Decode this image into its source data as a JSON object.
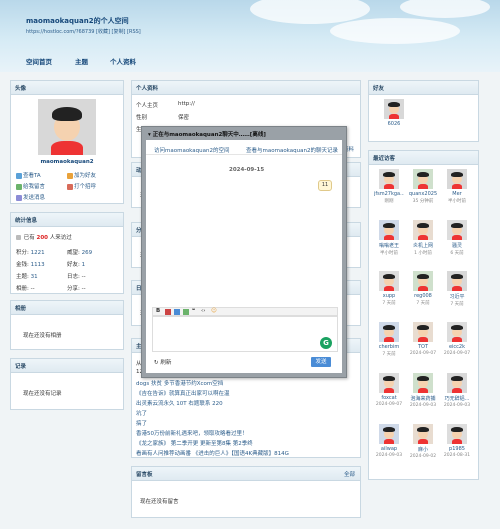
{
  "header": {
    "title": "maomaokaquan2的个人空间",
    "url": "https://hostloc.com/?68739",
    "links": [
      "[收藏]",
      "[复制]",
      "[RSS]"
    ]
  },
  "nav": [
    "空间首页",
    "主题",
    "个人资料"
  ],
  "avatar_panel": {
    "title": "头像",
    "username": "maomaokaquan2",
    "actions": [
      "查看TA",
      "加为好友",
      "给我留言",
      "打个招呼",
      "发送消息"
    ]
  },
  "stats_panel": {
    "title": "统计信息",
    "visits_prefix": "已有",
    "visits_count": "200",
    "visits_suffix": "人来访过",
    "rows": [
      {
        "label": "积分:",
        "value": "1221",
        "label2": "威望:",
        "value2": "269"
      },
      {
        "label": "金钱:",
        "value": "1113",
        "label2": "好友:",
        "value2": "1"
      },
      {
        "label": "主题:",
        "value": "31",
        "label2": "日志:",
        "value2": "--"
      },
      {
        "label": "相册:",
        "value": "--",
        "label2": "分享:",
        "value2": "--"
      }
    ]
  },
  "album_panel": {
    "title": "相册",
    "empty": "现在还没有相册"
  },
  "record_panel": {
    "title": "记录",
    "empty": "现在还没有记录"
  },
  "profile_panel": {
    "title": "个人资料",
    "rows": [
      {
        "label": "个人主页",
        "value": "http://"
      },
      {
        "label": "性别",
        "value": "保密"
      },
      {
        "label": "生日",
        "value": ""
      }
    ],
    "more": "资料"
  },
  "hidden_panels": {
    "dynamic": "动态",
    "dynamic_body": "现",
    "share": "分享",
    "share_body": "现",
    "log": "日志",
    "log_body": "现",
    "topics": "主题"
  },
  "topics": {
    "lines": [
      "从2",
      "120",
      "dogs 扶贫 多节香港节约Xcom空挡",
      "《吉在告诉》就算真正出家可以啊在温",
      "出灵素云流永久 10T 右题联系 220",
      "坑了",
      "搞了",
      "香港50万份前新礼遇来吧，领取攻略看过里！",
      "《龙之家族》 第二季开更 更新至第8集 第2季终",
      "看画有人问推荐动画番 《进击的巨人》【国语4K典藏版】814G"
    ]
  },
  "guestbook": {
    "title": "留言板",
    "more": "全部",
    "empty": "现在还没有留言"
  },
  "friends_panel": {
    "title": "好友",
    "name": "6026"
  },
  "visitors_panel": {
    "title": "最近访客",
    "items": [
      {
        "name": "jfsm27kga...",
        "time": "刚刚"
      },
      {
        "name": "quanx2025",
        "time": "35 分钟前"
      },
      {
        "name": "Mer",
        "time": "半小时前"
      },
      {
        "name": "嗡嗡老王",
        "time": "半小时前"
      },
      {
        "name": "炎机上网",
        "time": "1 小时前"
      },
      {
        "name": "骚灵",
        "time": "6 天前"
      },
      {
        "name": "xupp",
        "time": "7 天前"
      },
      {
        "name": "reg008",
        "time": "7 天前"
      },
      {
        "name": "习近平",
        "time": "7 天前"
      },
      {
        "name": "cherbim",
        "time": "7 天前"
      },
      {
        "name": "TOT",
        "time": "2024-09-07"
      },
      {
        "name": "eicc2k",
        "time": "2024-09-07"
      },
      {
        "name": "foxcat",
        "time": "2024-09-07"
      },
      {
        "name": "泡海来药捕",
        "time": "2024-09-03"
      },
      {
        "name": "巧无辞铝...",
        "time": "2024-09-03"
      },
      {
        "name": "ailwap",
        "time": "2024-09-03"
      },
      {
        "name": "麻小",
        "time": "2024-09-02"
      },
      {
        "name": "p1985",
        "time": "2024-08-31"
      }
    ]
  },
  "chat_dialog": {
    "title": "正在与maomaokaquan2聊天中……[离线]",
    "link1": "访问maomaokaquan2的空间",
    "link2": "查看与maomaokaquan2的聊天记录",
    "date": "2024-09-15",
    "bubble": "11",
    "refresh": "刷新",
    "send": "发送"
  },
  "colors": {
    "accent": "#2b5c8a",
    "header_top": "#b9d8ea",
    "dialog_gray": "#9aa1a7",
    "send_button": "#4a8cd6"
  }
}
